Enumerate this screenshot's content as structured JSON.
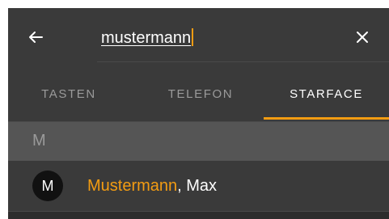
{
  "search": {
    "query": "mustermann"
  },
  "icons": {
    "back": "arrow-left-icon",
    "clear": "close-icon"
  },
  "tabs": [
    {
      "label": "TASTEN",
      "selected": false
    },
    {
      "label": "TELEFON",
      "selected": false
    },
    {
      "label": "STARFACE",
      "selected": true
    }
  ],
  "results": {
    "section_letter": "M",
    "contacts": [
      {
        "avatar_initial": "M",
        "name_match": "Mustermann",
        "name_rest": ", Max"
      }
    ]
  },
  "colors": {
    "accent": "#f39c12",
    "background": "#3a3a3a",
    "section_header": "#555555",
    "avatar": "#111111"
  }
}
